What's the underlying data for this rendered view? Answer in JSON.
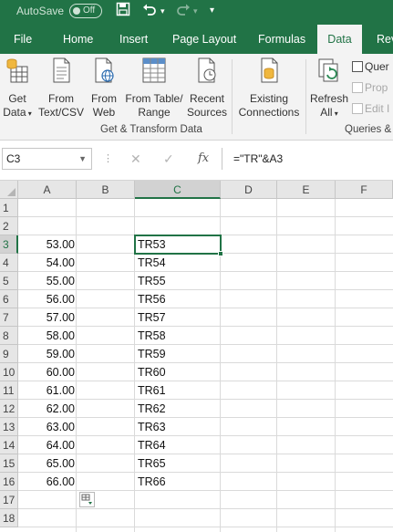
{
  "titlebar": {
    "autosave_label": "AutoSave",
    "autosave_state": "Off",
    "save_icon": "save-icon",
    "undo_icon": "undo-icon",
    "redo_icon": "redo-icon",
    "customize_icon": "customize-qat-icon"
  },
  "tabs": [
    {
      "label": "File",
      "active": false
    },
    {
      "label": "Home",
      "active": false
    },
    {
      "label": "Insert",
      "active": false
    },
    {
      "label": "Page Layout",
      "active": false
    },
    {
      "label": "Formulas",
      "active": false
    },
    {
      "label": "Data",
      "active": true
    },
    {
      "label": "Rev",
      "active": false
    }
  ],
  "ribbon": {
    "get_data": {
      "line1": "Get",
      "line2": "Data"
    },
    "from_text": {
      "line1": "From",
      "line2": "Text/CSV"
    },
    "from_web": {
      "line1": "From",
      "line2": "Web"
    },
    "from_table": {
      "line1": "From Table/",
      "line2": "Range"
    },
    "recent_sources": {
      "line1": "Recent",
      "line2": "Sources"
    },
    "existing_connections": {
      "line1": "Existing",
      "line2": "Connections"
    },
    "refresh_all": {
      "line1": "Refresh",
      "line2": "All"
    },
    "group_get_transform": "Get & Transform Data",
    "group_queries": "Queries &",
    "queries_items": [
      "Quer",
      "Prop",
      "Edit I"
    ]
  },
  "formula_bar": {
    "name_box": "C3",
    "formula": "=\"TR\"&A3",
    "fx_label": "fx"
  },
  "grid": {
    "columns": [
      "A",
      "B",
      "C",
      "D",
      "E",
      "F"
    ],
    "selected_column": "C",
    "selected_row": "3",
    "rows": [
      "1",
      "2",
      "3",
      "4",
      "5",
      "6",
      "7",
      "8",
      "9",
      "10",
      "11",
      "12",
      "13",
      "14",
      "15",
      "16",
      "17",
      "18"
    ],
    "col_a_values": [
      "53.00",
      "54.00",
      "55.00",
      "56.00",
      "57.00",
      "58.00",
      "59.00",
      "60.00",
      "61.00",
      "62.00",
      "63.00",
      "64.00",
      "65.00",
      "66.00"
    ],
    "col_c_values": [
      "TR53",
      "TR54",
      "TR55",
      "TR56",
      "TR57",
      "TR58",
      "TR59",
      "TR60",
      "TR61",
      "TR62",
      "TR63",
      "TR64",
      "TR65",
      "TR66"
    ],
    "quick_analysis_icon": "quick-analysis-icon"
  },
  "colors": {
    "accent": "#217346",
    "ribbon_bg": "#f3f3f3",
    "header_bg": "#e6e6e6",
    "gridline": "#dadada"
  }
}
